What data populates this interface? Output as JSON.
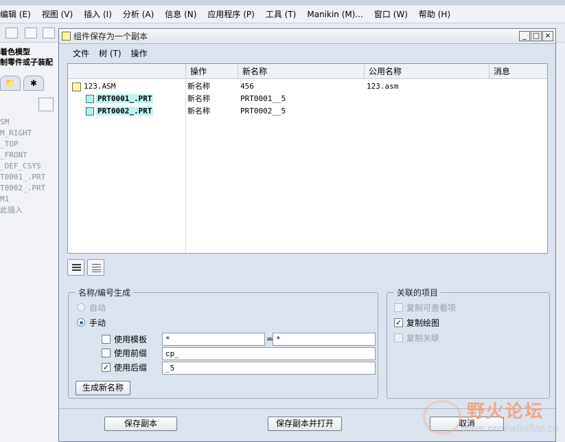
{
  "app": {
    "menu": [
      "编辑 (E)",
      "视图 (V)",
      "插入 (I)",
      "分析 (A)",
      "信息 (N)",
      "应用程序 (P)",
      "工具 (T)",
      "Manikin (M)...",
      "窗口 (W)",
      "帮助 (H)"
    ],
    "left_panel": {
      "header_line1": "着色模型",
      "header_line2": "制零件或子装配",
      "tab2_symbol": "✱",
      "tree": [
        "SM",
        "M_RIGHT",
        "_TOP",
        "_FRONT",
        "_DEF_CSYS",
        "T0001_.PRT",
        "T0002_.PRT",
        "M1",
        "此插入"
      ]
    }
  },
  "dialog": {
    "title": "组件保存为一个副本",
    "window_buttons": [
      "_",
      "□",
      "×"
    ],
    "menu": [
      "文件",
      "树 (T)",
      "操作"
    ],
    "table": {
      "columns": [
        "操作",
        "新名称",
        "公用名称",
        "消息"
      ],
      "rows": [
        {
          "name": "123.ASM",
          "action": "新名称",
          "new_name": "456",
          "common_name": "123.asm",
          "message": "",
          "type": "asm"
        },
        {
          "name": "PRT0001_.PRT",
          "action": "新名称",
          "new_name": "PRT0001__5",
          "common_name": "",
          "message": "",
          "type": "prt"
        },
        {
          "name": "PRT0002_.PRT",
          "action": "新名称",
          "new_name": "PRT0002__5",
          "common_name": "",
          "message": "",
          "type": "prt"
        }
      ]
    },
    "naming": {
      "legend": "名称/编号生成",
      "auto_label": "自动",
      "manual_label": "手动",
      "use_template_label": "使用模板",
      "use_prefix_label": "使用前缀",
      "use_suffix_label": "使用后缀",
      "template_value": "*",
      "template_equals": "=",
      "template_value2": "*",
      "prefix_value": "cp_",
      "suffix_value": "_5",
      "use_template_checked": false,
      "use_prefix_checked": false,
      "use_suffix_checked": true,
      "generate_button": "生成新名称"
    },
    "related": {
      "legend": "关联的项目",
      "copy_views_label": "复制可查看项",
      "copy_drawing_label": "复制绘图",
      "copy_relations_label": "复制关联"
    },
    "buttons": {
      "save_copy": "保存副本",
      "save_copy_open": "保存副本并打开",
      "cancel": "取消"
    }
  },
  "watermark": {
    "title": "野火论坛",
    "url": "www.proewildfire.cn"
  }
}
